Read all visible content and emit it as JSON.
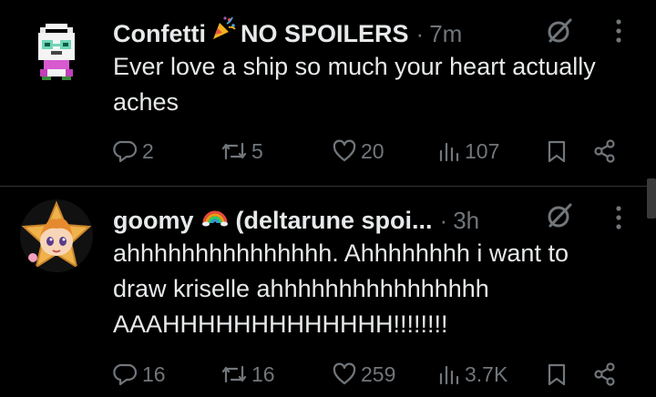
{
  "posts": [
    {
      "author": "Confetti",
      "author_suffix": "NO SPOILERS",
      "separator": "·",
      "time": "7m",
      "text": "Ever love a ship so much your heart actually aches",
      "stats": {
        "replies": "2",
        "reposts": "5",
        "likes": "20",
        "views": "107"
      }
    },
    {
      "author": "goomy",
      "author_suffix": "(deltarune spoi...",
      "separator": "·",
      "time": "3h",
      "text": "ahhhhhhhhhhhhhhh. Ahhhhhhhh i want to draw kriselle ahhhhhhhhhhhhhhhh AAAHHHHHHHHHHHHH!!!!!!!!",
      "stats": {
        "replies": "16",
        "reposts": "16",
        "likes": "259",
        "views": "3.7K"
      }
    }
  ],
  "icons": {
    "reply": "reply-icon",
    "repost": "repost-icon",
    "like": "heart-icon",
    "views": "views-icon",
    "bookmark": "bookmark-icon",
    "share": "share-icon",
    "grok": "grok-icon",
    "more": "more-icon"
  },
  "colors": {
    "background": "#000000",
    "text": "#e7e9ea",
    "secondary": "#71767b",
    "divider": "#2f3336"
  }
}
